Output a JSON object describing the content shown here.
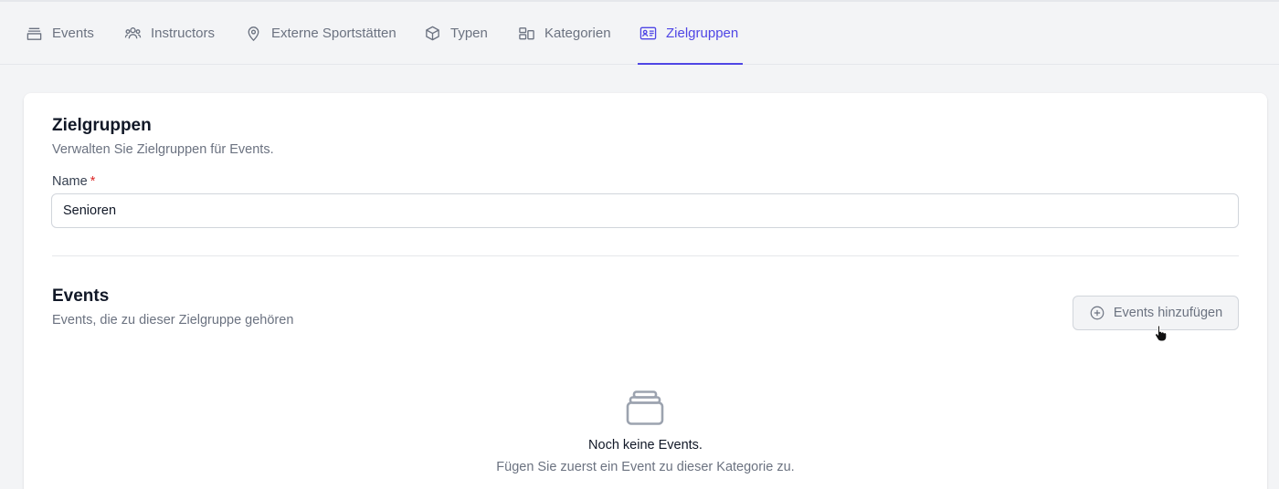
{
  "tabs": [
    {
      "label": "Events",
      "icon": "archive-icon",
      "active": false
    },
    {
      "label": "Instructors",
      "icon": "users-icon",
      "active": false
    },
    {
      "label": "Externe Sportstätten",
      "icon": "map-pin-icon",
      "active": false
    },
    {
      "label": "Typen",
      "icon": "cube-icon",
      "active": false
    },
    {
      "label": "Kategorien",
      "icon": "squares-icon",
      "active": false
    },
    {
      "label": "Zielgruppen",
      "icon": "id-card-icon",
      "active": true
    }
  ],
  "form": {
    "title": "Zielgruppen",
    "subtitle": "Verwalten Sie Zielgruppen für Events.",
    "name_label": "Name",
    "required_mark": "*",
    "name_value": "Senioren"
  },
  "events_section": {
    "title": "Events",
    "subtitle": "Events, die zu dieser Zielgruppe gehören",
    "add_button_label": "Events hinzufügen",
    "empty_title": "Noch keine Events.",
    "empty_subtitle": "Fügen Sie zuerst ein Event zu dieser Kategorie zu."
  },
  "colors": {
    "accent": "#4f46e5",
    "background": "#f3f4f6",
    "card": "#ffffff",
    "muted_text": "#6b7280",
    "required": "#dc2626"
  }
}
